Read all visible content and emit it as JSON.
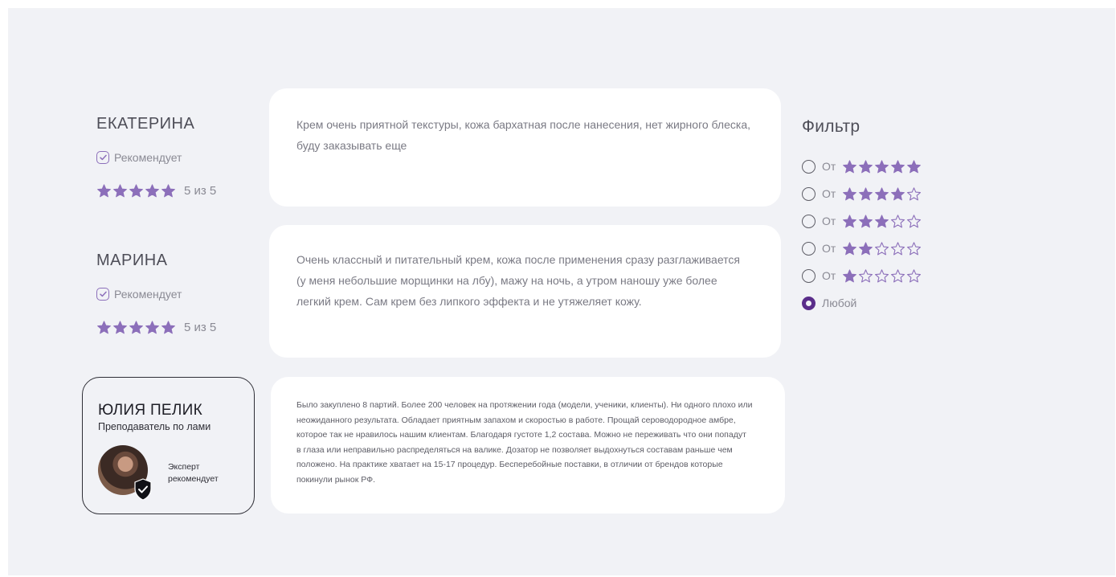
{
  "colors": {
    "star": "#8c6fba",
    "radio_checked": "#5a2d8a",
    "panel_bg": "#f1f2f6"
  },
  "reviews": [
    {
      "name": "ЕКАТЕРИНА",
      "recommend": "Рекомендует",
      "rating": 5,
      "score_text": "5 из 5",
      "text": "Крем очень приятной текстуры, кожа бархатная после нанесения, нет жирного блеска, буду заказывать еще"
    },
    {
      "name": "МАРИНА",
      "recommend": "Рекомендует",
      "rating": 5,
      "score_text": "5 из 5",
      "text": "Очень классный и питательный крем, кожа после применения сразу разглаживается (у меня небольшие морщинки на лбу), мажу на ночь, а утром наношу уже более легкий крем. Сам крем без липкого эффекта и не утяжеляет кожу."
    }
  ],
  "expert": {
    "name": "ЮЛИЯ ПЕЛИК",
    "role": "Преподаватель по лами",
    "label_line1": "Эксперт",
    "label_line2": "рекомендует",
    "badge_icon": "shield-check-icon",
    "text": "Было закуплено 8 партий. Более 200 человек на протяжении года (модели, ученики, клиенты). Ни одного плохо или неожиданного результата. Обладает приятным запахом и скоростью в работе.  Прощай сероводородное амбре, которое так не нравилось нашим клиентам.  Благодаря густоте 1,2 состава. Можно не переживать что они попадут в глаза или неправильно распределяться на валике.  Дозатор не позволяет выдохнуться составам раньше чем положено.  На практике хватает на 15-17 процедур. Бесперебойные поставки, в отличии от брендов которые покинули рынок РФ."
  },
  "filter": {
    "title": "Фильтр",
    "from_label": "От",
    "options": [
      {
        "stars": 5,
        "selected": false
      },
      {
        "stars": 4,
        "selected": false
      },
      {
        "stars": 3,
        "selected": false
      },
      {
        "stars": 2,
        "selected": false
      },
      {
        "stars": 1,
        "selected": false
      }
    ],
    "any_label": "Любой",
    "any_selected": true
  }
}
